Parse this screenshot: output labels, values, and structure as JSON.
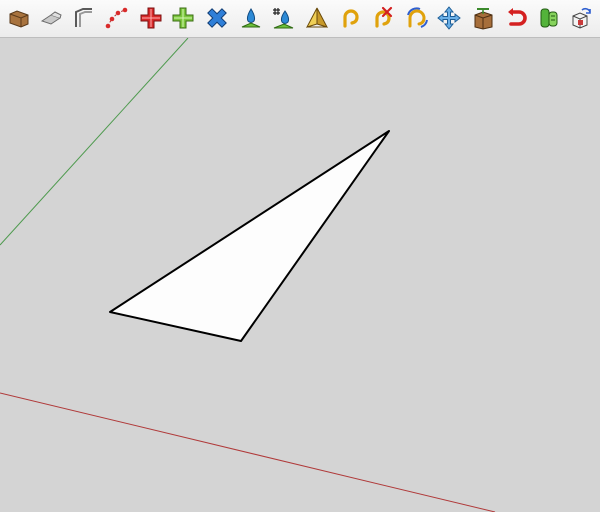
{
  "toolbar": {
    "tools": [
      {
        "icon": "follow-me-icon"
      },
      {
        "icon": "eraser-icon"
      },
      {
        "icon": "offset-icon"
      },
      {
        "icon": "curve-points-icon"
      },
      {
        "icon": "red-cross-icon"
      },
      {
        "icon": "green-cross-icon"
      },
      {
        "icon": "blue-rotate-cross-icon"
      },
      {
        "icon": "drape-icon"
      },
      {
        "icon": "numbered-drape-icon"
      },
      {
        "icon": "pyramid-icon"
      },
      {
        "icon": "arc-icon"
      },
      {
        "icon": "arc-delete-icon"
      },
      {
        "icon": "rotate-arc-icon"
      },
      {
        "icon": "move-arrows-icon"
      },
      {
        "icon": "extrude-box-icon"
      },
      {
        "icon": "magnet-undo-icon"
      },
      {
        "icon": "green-cylinder-icon"
      },
      {
        "icon": "flip-cube-icon"
      }
    ]
  },
  "viewport": {
    "background_color": "#d4d4d4",
    "green_axis_color": "#4e9a4e",
    "red_axis_color": "#b03a3a",
    "face_fill_color": "#fdfdfd",
    "edge_color": "#000000"
  }
}
